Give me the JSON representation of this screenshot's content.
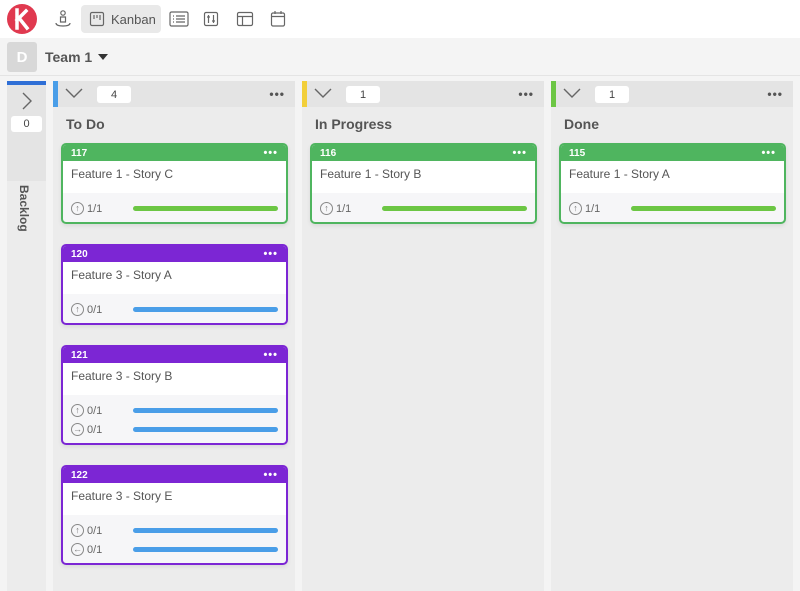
{
  "toolbar": {
    "logo": "k-logo",
    "items": [
      {
        "icon": "user-location-icon",
        "label": ""
      },
      {
        "icon": "kanban-icon",
        "label": "Kanban",
        "active": true
      },
      {
        "icon": "list-icon",
        "label": ""
      },
      {
        "icon": "sliders-icon",
        "label": ""
      },
      {
        "icon": "layout-icon",
        "label": ""
      },
      {
        "icon": "calendar-icon",
        "label": ""
      }
    ],
    "kanban_label": "Kanban"
  },
  "team": {
    "avatar_letter": "D",
    "name": "Team 1"
  },
  "backlog": {
    "label": "Backlog",
    "count": "0",
    "stripe_color": "#2f6fd6"
  },
  "columns": [
    {
      "title": "To Do",
      "count": "4",
      "stripe_color": "#4a9ee8",
      "cards": [
        {
          "id": "117",
          "title": "Feature 1 - Story C",
          "color": "#4fb55f",
          "tasks": [
            {
              "icon": "arrow-up",
              "value": "1/1",
              "bar_color": "#6cc644",
              "progress": 1
            }
          ]
        },
        {
          "id": "120",
          "title": "Feature 3 - Story A",
          "color": "#7c26d4",
          "tasks": [
            {
              "icon": "arrow-up",
              "value": "0/1",
              "bar_color": "#4a9ee8",
              "progress": 1
            }
          ]
        },
        {
          "id": "121",
          "title": "Feature 3 - Story B",
          "color": "#7c26d4",
          "tasks": [
            {
              "icon": "arrow-up",
              "value": "0/1",
              "bar_color": "#4a9ee8",
              "progress": 1
            },
            {
              "icon": "arrow-right",
              "value": "0/1",
              "bar_color": "#4a9ee8",
              "progress": 1
            }
          ]
        },
        {
          "id": "122",
          "title": "Feature 3 - Story E",
          "color": "#7c26d4",
          "tasks": [
            {
              "icon": "arrow-up",
              "value": "0/1",
              "bar_color": "#4a9ee8",
              "progress": 1
            },
            {
              "icon": "arrow-left",
              "value": "0/1",
              "bar_color": "#4a9ee8",
              "progress": 1
            }
          ]
        }
      ]
    },
    {
      "title": "In Progress",
      "count": "1",
      "stripe_color": "#f2cf3a",
      "cards": [
        {
          "id": "116",
          "title": "Feature 1 - Story B",
          "color": "#4fb55f",
          "tasks": [
            {
              "icon": "arrow-up",
              "value": "1/1",
              "bar_color": "#6cc644",
              "progress": 1
            }
          ]
        }
      ]
    },
    {
      "title": "Done",
      "count": "1",
      "stripe_color": "#6cc644",
      "cards": [
        {
          "id": "115",
          "title": "Feature 1 - Story A",
          "color": "#4fb55f",
          "tasks": [
            {
              "icon": "arrow-up",
              "value": "1/1",
              "bar_color": "#6cc644",
              "progress": 1
            }
          ]
        }
      ]
    }
  ],
  "more_glyph": "•••"
}
